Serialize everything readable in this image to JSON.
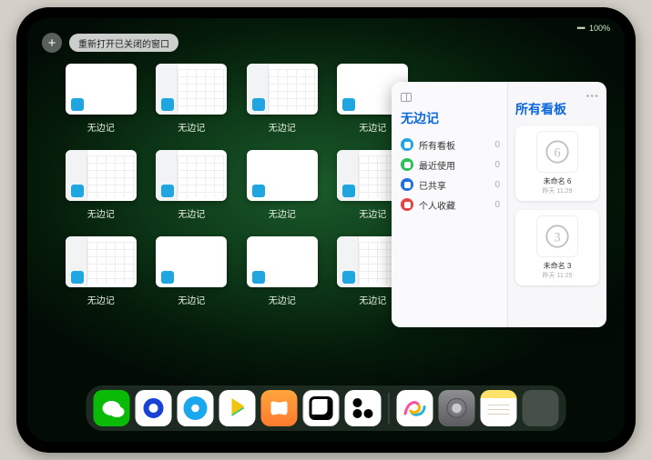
{
  "status": {
    "battery": "100%",
    "signal": "••••"
  },
  "topbar": {
    "plus": "+",
    "reopen_label": "重新打开已关闭的窗口"
  },
  "window_tiles": [
    {
      "label": "无边记",
      "variant": "blank"
    },
    {
      "label": "无边记",
      "variant": "cal"
    },
    {
      "label": "无边记",
      "variant": "cal"
    },
    {
      "label": "无边记",
      "variant": "blank"
    },
    {
      "label": "无边记",
      "variant": "cal"
    },
    {
      "label": "无边记",
      "variant": "cal"
    },
    {
      "label": "无边记",
      "variant": "blank"
    },
    {
      "label": "无边记",
      "variant": "cal"
    },
    {
      "label": "无边记",
      "variant": "cal"
    },
    {
      "label": "无边记",
      "variant": "blank"
    },
    {
      "label": "无边记",
      "variant": "blank"
    },
    {
      "label": "无边记",
      "variant": "cal"
    }
  ],
  "panel": {
    "left_title": "无边记",
    "right_title": "所有看板",
    "more": "•••",
    "items": [
      {
        "label": "所有看板",
        "count": 0,
        "color": "pi-blue"
      },
      {
        "label": "最近使用",
        "count": 0,
        "color": "pi-green"
      },
      {
        "label": "已共享",
        "count": 0,
        "color": "pi-dblue"
      },
      {
        "label": "个人收藏",
        "count": 0,
        "color": "pi-red"
      }
    ],
    "boards": [
      {
        "name": "未命名 6",
        "sub": "昨天 11:29",
        "digit": "6"
      },
      {
        "name": "未命名 3",
        "sub": "昨天 11:25",
        "digit": "3"
      }
    ]
  },
  "dock": {
    "icons": [
      "wechat",
      "hdplayer",
      "browser",
      "play",
      "books",
      "dice",
      "ctrl"
    ],
    "right_icons": [
      "freeform",
      "settings",
      "notes",
      "group"
    ]
  }
}
